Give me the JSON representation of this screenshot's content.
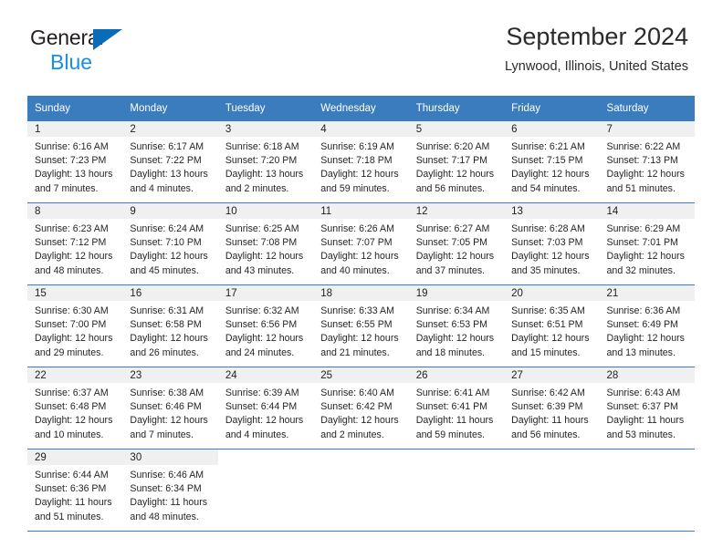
{
  "brand": {
    "line1": "General",
    "line2": "Blue",
    "triangle_color": "#0a6cb8",
    "blue_text_color": "#1a8fe0"
  },
  "header": {
    "title": "September 2024",
    "subtitle": "Lynwood, Illinois, United States"
  },
  "colors": {
    "header_row_bg": "#3b7cbf",
    "header_row_text": "#ffffff",
    "daynum_band_bg": "#f0f0f0",
    "row_divider": "#3b7cbf",
    "body_text": "#252525"
  },
  "weekday_headers": [
    "Sunday",
    "Monday",
    "Tuesday",
    "Wednesday",
    "Thursday",
    "Friday",
    "Saturday"
  ],
  "weeks": [
    [
      {
        "day": "1",
        "sunrise": "Sunrise: 6:16 AM",
        "sunset": "Sunset: 7:23 PM",
        "daylight1": "Daylight: 13 hours",
        "daylight2": "and 7 minutes."
      },
      {
        "day": "2",
        "sunrise": "Sunrise: 6:17 AM",
        "sunset": "Sunset: 7:22 PM",
        "daylight1": "Daylight: 13 hours",
        "daylight2": "and 4 minutes."
      },
      {
        "day": "3",
        "sunrise": "Sunrise: 6:18 AM",
        "sunset": "Sunset: 7:20 PM",
        "daylight1": "Daylight: 13 hours",
        "daylight2": "and 2 minutes."
      },
      {
        "day": "4",
        "sunrise": "Sunrise: 6:19 AM",
        "sunset": "Sunset: 7:18 PM",
        "daylight1": "Daylight: 12 hours",
        "daylight2": "and 59 minutes."
      },
      {
        "day": "5",
        "sunrise": "Sunrise: 6:20 AM",
        "sunset": "Sunset: 7:17 PM",
        "daylight1": "Daylight: 12 hours",
        "daylight2": "and 56 minutes."
      },
      {
        "day": "6",
        "sunrise": "Sunrise: 6:21 AM",
        "sunset": "Sunset: 7:15 PM",
        "daylight1": "Daylight: 12 hours",
        "daylight2": "and 54 minutes."
      },
      {
        "day": "7",
        "sunrise": "Sunrise: 6:22 AM",
        "sunset": "Sunset: 7:13 PM",
        "daylight1": "Daylight: 12 hours",
        "daylight2": "and 51 minutes."
      }
    ],
    [
      {
        "day": "8",
        "sunrise": "Sunrise: 6:23 AM",
        "sunset": "Sunset: 7:12 PM",
        "daylight1": "Daylight: 12 hours",
        "daylight2": "and 48 minutes."
      },
      {
        "day": "9",
        "sunrise": "Sunrise: 6:24 AM",
        "sunset": "Sunset: 7:10 PM",
        "daylight1": "Daylight: 12 hours",
        "daylight2": "and 45 minutes."
      },
      {
        "day": "10",
        "sunrise": "Sunrise: 6:25 AM",
        "sunset": "Sunset: 7:08 PM",
        "daylight1": "Daylight: 12 hours",
        "daylight2": "and 43 minutes."
      },
      {
        "day": "11",
        "sunrise": "Sunrise: 6:26 AM",
        "sunset": "Sunset: 7:07 PM",
        "daylight1": "Daylight: 12 hours",
        "daylight2": "and 40 minutes."
      },
      {
        "day": "12",
        "sunrise": "Sunrise: 6:27 AM",
        "sunset": "Sunset: 7:05 PM",
        "daylight1": "Daylight: 12 hours",
        "daylight2": "and 37 minutes."
      },
      {
        "day": "13",
        "sunrise": "Sunrise: 6:28 AM",
        "sunset": "Sunset: 7:03 PM",
        "daylight1": "Daylight: 12 hours",
        "daylight2": "and 35 minutes."
      },
      {
        "day": "14",
        "sunrise": "Sunrise: 6:29 AM",
        "sunset": "Sunset: 7:01 PM",
        "daylight1": "Daylight: 12 hours",
        "daylight2": "and 32 minutes."
      }
    ],
    [
      {
        "day": "15",
        "sunrise": "Sunrise: 6:30 AM",
        "sunset": "Sunset: 7:00 PM",
        "daylight1": "Daylight: 12 hours",
        "daylight2": "and 29 minutes."
      },
      {
        "day": "16",
        "sunrise": "Sunrise: 6:31 AM",
        "sunset": "Sunset: 6:58 PM",
        "daylight1": "Daylight: 12 hours",
        "daylight2": "and 26 minutes."
      },
      {
        "day": "17",
        "sunrise": "Sunrise: 6:32 AM",
        "sunset": "Sunset: 6:56 PM",
        "daylight1": "Daylight: 12 hours",
        "daylight2": "and 24 minutes."
      },
      {
        "day": "18",
        "sunrise": "Sunrise: 6:33 AM",
        "sunset": "Sunset: 6:55 PM",
        "daylight1": "Daylight: 12 hours",
        "daylight2": "and 21 minutes."
      },
      {
        "day": "19",
        "sunrise": "Sunrise: 6:34 AM",
        "sunset": "Sunset: 6:53 PM",
        "daylight1": "Daylight: 12 hours",
        "daylight2": "and 18 minutes."
      },
      {
        "day": "20",
        "sunrise": "Sunrise: 6:35 AM",
        "sunset": "Sunset: 6:51 PM",
        "daylight1": "Daylight: 12 hours",
        "daylight2": "and 15 minutes."
      },
      {
        "day": "21",
        "sunrise": "Sunrise: 6:36 AM",
        "sunset": "Sunset: 6:49 PM",
        "daylight1": "Daylight: 12 hours",
        "daylight2": "and 13 minutes."
      }
    ],
    [
      {
        "day": "22",
        "sunrise": "Sunrise: 6:37 AM",
        "sunset": "Sunset: 6:48 PM",
        "daylight1": "Daylight: 12 hours",
        "daylight2": "and 10 minutes."
      },
      {
        "day": "23",
        "sunrise": "Sunrise: 6:38 AM",
        "sunset": "Sunset: 6:46 PM",
        "daylight1": "Daylight: 12 hours",
        "daylight2": "and 7 minutes."
      },
      {
        "day": "24",
        "sunrise": "Sunrise: 6:39 AM",
        "sunset": "Sunset: 6:44 PM",
        "daylight1": "Daylight: 12 hours",
        "daylight2": "and 4 minutes."
      },
      {
        "day": "25",
        "sunrise": "Sunrise: 6:40 AM",
        "sunset": "Sunset: 6:42 PM",
        "daylight1": "Daylight: 12 hours",
        "daylight2": "and 2 minutes."
      },
      {
        "day": "26",
        "sunrise": "Sunrise: 6:41 AM",
        "sunset": "Sunset: 6:41 PM",
        "daylight1": "Daylight: 11 hours",
        "daylight2": "and 59 minutes."
      },
      {
        "day": "27",
        "sunrise": "Sunrise: 6:42 AM",
        "sunset": "Sunset: 6:39 PM",
        "daylight1": "Daylight: 11 hours",
        "daylight2": "and 56 minutes."
      },
      {
        "day": "28",
        "sunrise": "Sunrise: 6:43 AM",
        "sunset": "Sunset: 6:37 PM",
        "daylight1": "Daylight: 11 hours",
        "daylight2": "and 53 minutes."
      }
    ],
    [
      {
        "day": "29",
        "sunrise": "Sunrise: 6:44 AM",
        "sunset": "Sunset: 6:36 PM",
        "daylight1": "Daylight: 11 hours",
        "daylight2": "and 51 minutes."
      },
      {
        "day": "30",
        "sunrise": "Sunrise: 6:46 AM",
        "sunset": "Sunset: 6:34 PM",
        "daylight1": "Daylight: 11 hours",
        "daylight2": "and 48 minutes."
      },
      {
        "day": "",
        "sunrise": "",
        "sunset": "",
        "daylight1": "",
        "daylight2": ""
      },
      {
        "day": "",
        "sunrise": "",
        "sunset": "",
        "daylight1": "",
        "daylight2": ""
      },
      {
        "day": "",
        "sunrise": "",
        "sunset": "",
        "daylight1": "",
        "daylight2": ""
      },
      {
        "day": "",
        "sunrise": "",
        "sunset": "",
        "daylight1": "",
        "daylight2": ""
      },
      {
        "day": "",
        "sunrise": "",
        "sunset": "",
        "daylight1": "",
        "daylight2": ""
      }
    ]
  ]
}
